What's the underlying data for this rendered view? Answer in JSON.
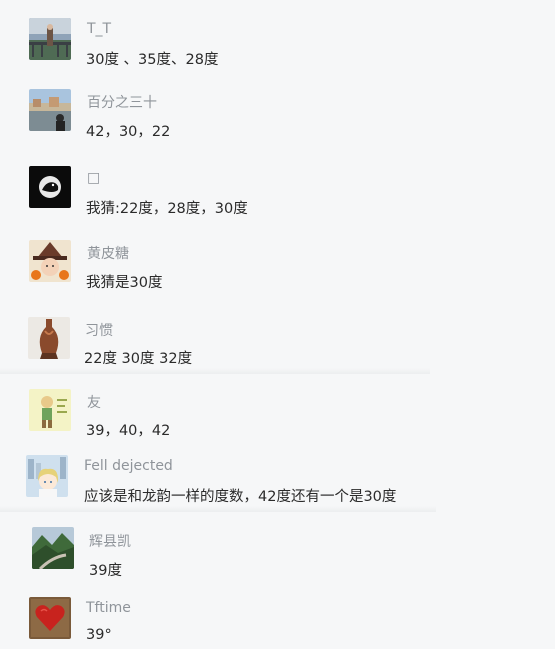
{
  "comments": [
    {
      "username": "T_T",
      "text": "30度 、35度、28度",
      "avatar_icon": "bridge-photo-avatar-icon"
    },
    {
      "username": "百分之三十",
      "text": "42，30，22",
      "avatar_icon": "landscape-photo-avatar-icon"
    },
    {
      "username": "□",
      "text": "我猜:22度，28度，30度",
      "avatar_icon": "bird-moon-avatar-icon"
    },
    {
      "username": "黄皮糖",
      "text": "我猜是30度",
      "avatar_icon": "witch-girl-avatar-icon"
    },
    {
      "username": "习惯",
      "text": "22度  30度  32度",
      "avatar_icon": "vase-avatar-icon"
    },
    {
      "username": "友",
      "text": "39，40，42",
      "avatar_icon": "cartoon-figure-avatar-icon"
    },
    {
      "username": "Fell dejected",
      "text": "应该是和龙韵一样的度数，42度还有一个是30度",
      "avatar_icon": "anime-girl-avatar-icon"
    },
    {
      "username": "辉县凯",
      "text": "39度",
      "avatar_icon": "mountain-road-avatar-icon"
    },
    {
      "username": "Tftime",
      "text": "39°",
      "avatar_icon": "red-heart-avatar-icon"
    }
  ]
}
